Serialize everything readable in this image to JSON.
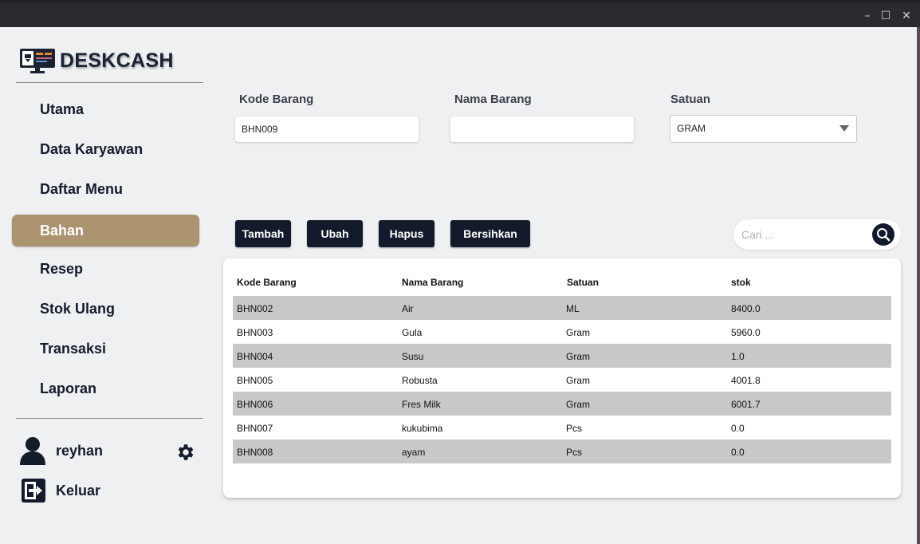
{
  "window_controls": {
    "minimize": "–",
    "maximize": "☐",
    "close": "✕"
  },
  "brand": {
    "name": "DESKCASH",
    "icon": "monitor-icon"
  },
  "sidebar": {
    "items": [
      {
        "label": "Utama",
        "active": false
      },
      {
        "label": "Data Karyawan",
        "active": false
      },
      {
        "label": "Daftar Menu",
        "active": false
      },
      {
        "label": "Bahan",
        "active": true
      },
      {
        "label": "Resep",
        "active": false
      },
      {
        "label": "Stok Ulang",
        "active": false
      },
      {
        "label": "Transaksi",
        "active": false
      },
      {
        "label": "Laporan",
        "active": false
      }
    ],
    "active_color": "#ad9471"
  },
  "user": {
    "name": "reyhan",
    "icon": "user-icon",
    "settings_icon": "gear-icon"
  },
  "logout": {
    "label": "Keluar",
    "icon": "logout-icon"
  },
  "form": {
    "kode_label": "Kode Barang",
    "kode_value": "BHN009",
    "nama_label": "Nama Barang",
    "nama_value": "",
    "satuan_label": "Satuan",
    "satuan_value": "GRAM"
  },
  "buttons": {
    "tambah": "Tambah",
    "ubah": "Ubah",
    "hapus": "Hapus",
    "bersihkan": "Bersihkan"
  },
  "search": {
    "placeholder": "Cari ...",
    "icon": "search-icon"
  },
  "table": {
    "headers": [
      "Kode Barang",
      "Nama Barang",
      "Satuan",
      "stok"
    ],
    "rows": [
      [
        "BHN002",
        "Air",
        "ML",
        "8400.0"
      ],
      [
        "BHN003",
        "Gula",
        "Gram",
        "5960.0"
      ],
      [
        "BHN004",
        "Susu",
        "Gram",
        "1.0"
      ],
      [
        "BHN005",
        "Robusta",
        "Gram",
        "4001.8"
      ],
      [
        "BHN006",
        "Fres Milk",
        "Gram",
        "6001.7"
      ],
      [
        "BHN007",
        "kukubima",
        "Pcs",
        "0.0"
      ],
      [
        "BHN008",
        "ayam",
        "Pcs",
        "0.0"
      ]
    ]
  },
  "colors": {
    "dark": "#121a2b",
    "row_stripe": "#c8c8c8",
    "background": "#eff0f2"
  }
}
